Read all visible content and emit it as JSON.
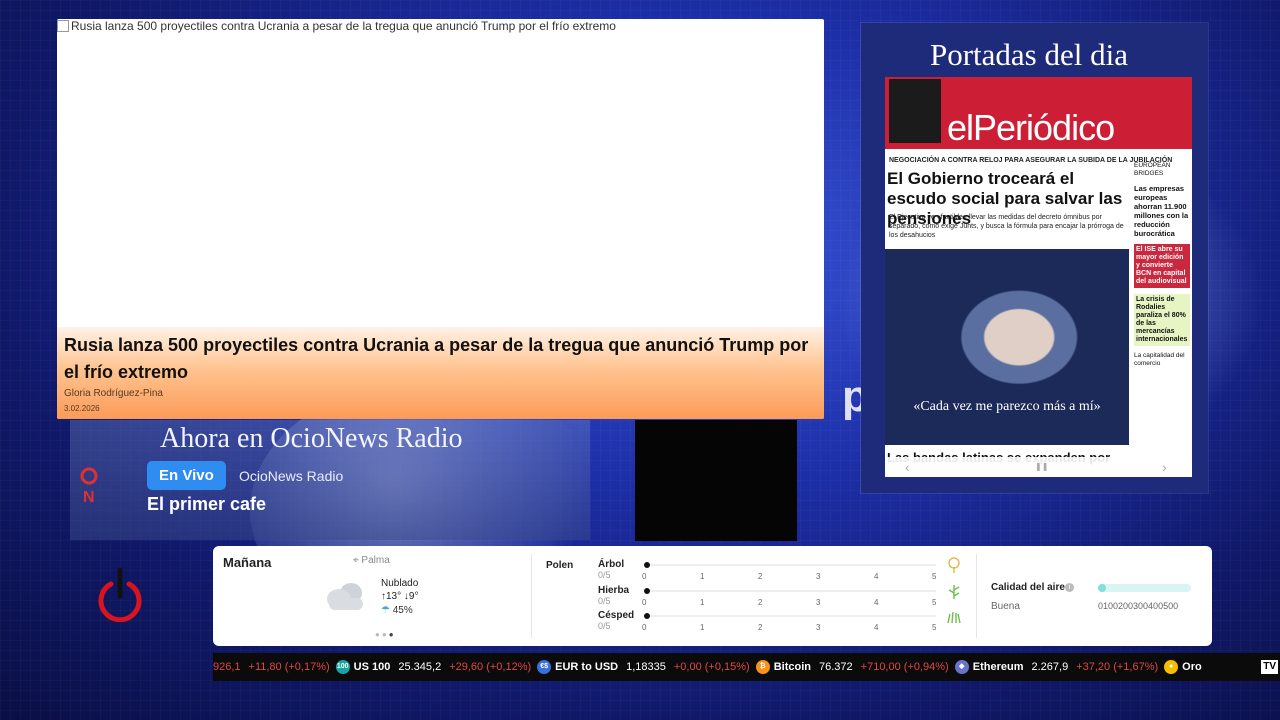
{
  "news": {
    "image_alt": "Rusia lanza 500 proyectiles contra Ucrania a pesar de la tregua que anunció Trump por el frío extremo",
    "headline": "Rusia lanza 500 proyectiles contra Ucrania a pesar de la tregua que anunció Trump por el frío extremo",
    "author": "Gloria Rodríguez-Pina",
    "date": "3.02.2026"
  },
  "radio": {
    "title": "Ahora en OcioNews Radio",
    "live_label": "En Vivo",
    "station": "OcioNews Radio",
    "program": "El primer cafe"
  },
  "background_text": "po",
  "portadas": {
    "title": "Portadas del dia",
    "paper": {
      "name": "elPeriódico",
      "kicker": "NEGOCIACIÓN A CONTRA RELOJ PARA ASEGURAR LA SUBIDA DE LA JUBILACIÓN",
      "lead": "El Gobierno troceará el escudo social para salvar las pensiones",
      "lead_desc": "El Ejecutivo ve «factible» llevar las medidas del decreto ómnibus por separado, como exige Junts, y busca la fórmula para encajar la prórroga de los desahucios",
      "quote": "«Cada vez me parezco más a mí»",
      "bottom_head": "Las bandas latinas se expanden por",
      "side": {
        "section": "EUROPEAN BRIDGES",
        "s1": "Las empresas europeas ahorran 11.900 millones con la reducción burocrática",
        "s2": "El ISE abre su mayor edición y convierte BCN en capital del audiovisual",
        "s3": "La crisis de Rodalies paraliza el 80% de las mercancías internacionales",
        "s4": "La capitalidad del comercio"
      }
    }
  },
  "weather": {
    "day": "Mañana",
    "location": "Palma",
    "condition": "Nublado",
    "temp_max": "13°",
    "temp_min": "9°",
    "rain_prob": "45%",
    "carousel_index": 3,
    "carousel_total": 3,
    "polen_label": "Polen",
    "polen": [
      {
        "name": "Árbol",
        "value": "0/5",
        "level": 0,
        "icon": "tree-icon",
        "color": "#e3b13a"
      },
      {
        "name": "Hierba",
        "value": "0/5",
        "level": 0,
        "icon": "herb-icon",
        "color": "#6cc04a"
      },
      {
        "name": "Césped",
        "value": "0/5",
        "level": 0,
        "icon": "grass-icon",
        "color": "#6cc04a"
      }
    ],
    "polen_scale": [
      "0",
      "1",
      "2",
      "3",
      "4",
      "5"
    ],
    "air_label": "Calidad del aire",
    "air_value": "Buena",
    "air_fraction": 0.05,
    "air_scale": "0100200300400500"
  },
  "ticker": [
    {
      "name": "",
      "value": "926,1",
      "change": "+11,80 (+0,17%)",
      "icon": "",
      "icon_color": ""
    },
    {
      "name": "US 100",
      "value": "25.345,2",
      "change": "+29,60 (+0,12%)",
      "icon": "100",
      "icon_color": "#1aa3a3"
    },
    {
      "name": "EUR to USD",
      "value": "1,18335",
      "change": "+0,00 (+0,15%)",
      "icon": "€$",
      "icon_color": "#3a6fd8"
    },
    {
      "name": "Bitcoin",
      "value": "76.372",
      "change": "+710,00 (+0,94%)",
      "icon": "₿",
      "icon_color": "#f7931a"
    },
    {
      "name": "Ethereum",
      "value": "2.267,9",
      "change": "+37,20 (+1,67%)",
      "icon": "◆",
      "icon_color": "#6b73c9"
    },
    {
      "name": "Oro",
      "value": "",
      "change": "",
      "icon": "●",
      "icon_color": "#f2c000"
    }
  ],
  "ticker_brand": "TV",
  "colors": {
    "live": "#2f8cf0",
    "ticker_change": "#e0454a",
    "power": "#d9141e",
    "paper_red": "#cc1f36"
  }
}
